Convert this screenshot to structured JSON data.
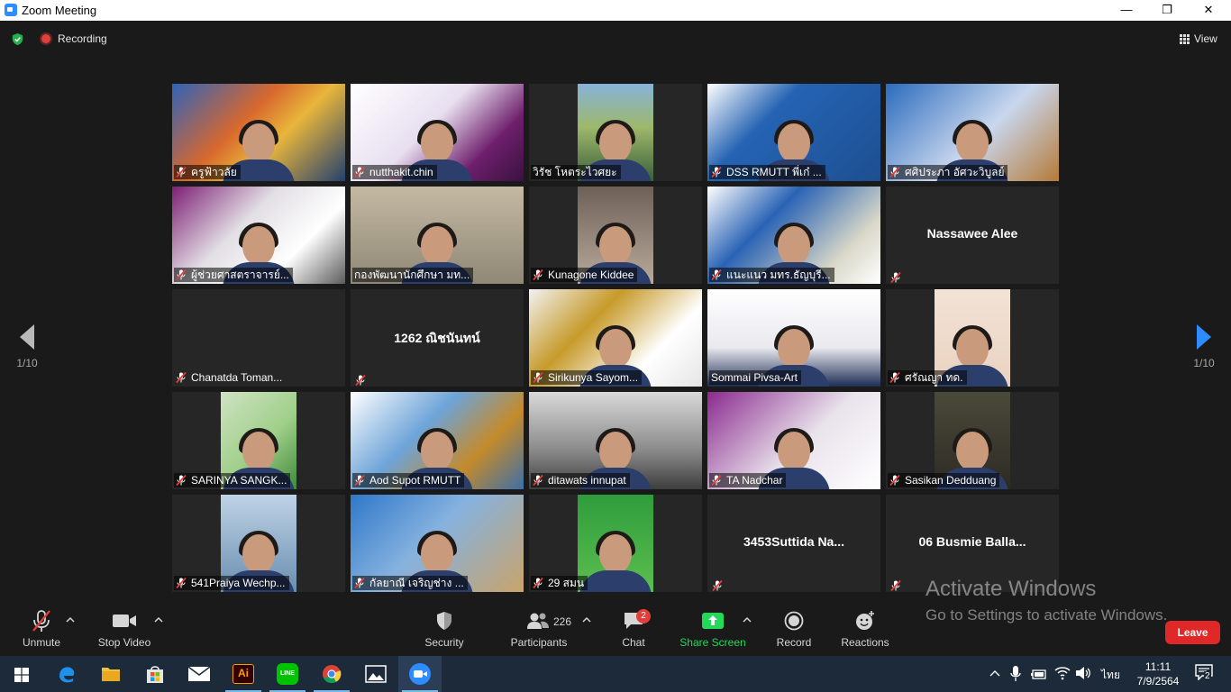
{
  "window": {
    "title": "Zoom Meeting",
    "minimize": "—",
    "restore": "❐",
    "close": "✕"
  },
  "topbar": {
    "recording_label": "Recording",
    "view_label": "View"
  },
  "pager": {
    "left_label": "1/10",
    "right_label": "1/10"
  },
  "participants": [
    {
      "name": "ครูฟ้าวลัย",
      "type": "video",
      "muted": true
    },
    {
      "name": "nutthakit.chin",
      "type": "video",
      "muted": true
    },
    {
      "name": "วิรัช  โหตระไวศยะ",
      "type": "video",
      "muted": false
    },
    {
      "name": "DSS RMUTT พี่เก๋ ...",
      "type": "video",
      "muted": true
    },
    {
      "name": "ศศิประภา อัศวะวิบูลย์",
      "type": "video",
      "muted": true
    },
    {
      "name": "ผู้ช่วยศาสตราจารย์...",
      "type": "video",
      "muted": true
    },
    {
      "name": "กองพัฒนานักศึกษา มท...",
      "type": "video",
      "muted": false,
      "active": true
    },
    {
      "name": "Kunagone Kiddee",
      "type": "video",
      "muted": true
    },
    {
      "name": "แนะแนว มทร.ธัญบุรี...",
      "type": "video",
      "muted": true
    },
    {
      "name": "Nassawee Alee",
      "type": "name",
      "muted": true
    },
    {
      "name": "Chanatda Toman...",
      "type": "blank",
      "muted": true
    },
    {
      "name": "1262 ณิชนันทน์",
      "type": "name",
      "muted": true
    },
    {
      "name": "Sirikunya Sayom...",
      "type": "video",
      "muted": true
    },
    {
      "name": "Sommai Pivsa-Art",
      "type": "video",
      "muted": false
    },
    {
      "name": "ศรัณญา ทด.",
      "type": "video",
      "muted": true
    },
    {
      "name": "SARINYA SANGK...",
      "type": "video",
      "muted": true
    },
    {
      "name": "Aod Supot RMUTT",
      "type": "video",
      "muted": true
    },
    {
      "name": "ditawats innupat",
      "type": "video",
      "muted": true
    },
    {
      "name": "TA Nadchar",
      "type": "video",
      "muted": true
    },
    {
      "name": "Sasikan Dedduang",
      "type": "video",
      "muted": true
    },
    {
      "name": "541Praiya Wechp...",
      "type": "video",
      "muted": true
    },
    {
      "name": "กัลยาณี เจริญช่าง ...",
      "type": "video",
      "muted": true
    },
    {
      "name": "29 สมน",
      "type": "video",
      "muted": true
    },
    {
      "name": "3453Suttida Na...",
      "type": "name",
      "muted": true
    },
    {
      "name": "06 Busmie Balla...",
      "type": "name",
      "muted": true
    }
  ],
  "controls": {
    "unmute": "Unmute",
    "stop_video": "Stop Video",
    "security": "Security",
    "participants": "Participants",
    "participants_count": "226",
    "chat": "Chat",
    "chat_badge": "2",
    "share_screen": "Share Screen",
    "record": "Record",
    "reactions": "Reactions",
    "leave": "Leave"
  },
  "watermark": {
    "line1": "Activate Windows",
    "line2": "Go to Settings to activate Windows."
  },
  "taskbar": {
    "apps": [
      "windows-start",
      "edge",
      "file-explorer",
      "store",
      "mail",
      "illustrator",
      "line",
      "chrome",
      "photos",
      "zoom"
    ],
    "illustrator_label": "Ai",
    "line_label": "LINE",
    "language": "ไทย",
    "time": "11:11",
    "date": "7/9/2564",
    "notification_count": "2"
  },
  "colors": {
    "accent": "#2d8cff",
    "leave": "#e02828",
    "share": "#23d959",
    "active_speaker": "#e6e46a",
    "muted": "#e0403c"
  }
}
